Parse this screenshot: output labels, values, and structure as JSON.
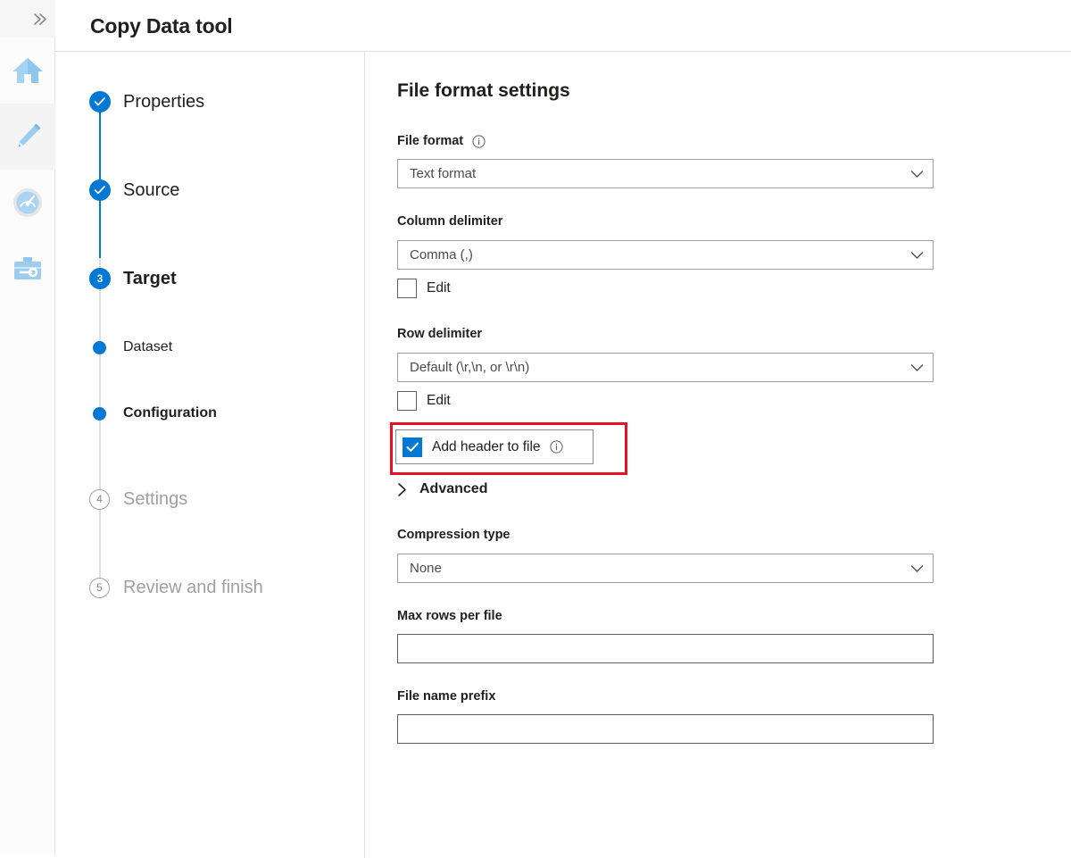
{
  "header": {
    "title": "Copy Data tool"
  },
  "rail": {
    "expand_icon": "double-chevron-right-icon",
    "items": [
      {
        "icon": "home-icon",
        "name": "home"
      },
      {
        "icon": "pencil-icon",
        "name": "author"
      },
      {
        "icon": "monitor-gauge-icon",
        "name": "monitor"
      },
      {
        "icon": "toolbox-icon",
        "name": "manage"
      }
    ]
  },
  "steps": [
    {
      "label": "Properties",
      "state": "done",
      "marker": "check"
    },
    {
      "label": "Source",
      "state": "done",
      "marker": "check"
    },
    {
      "label": "Target",
      "state": "current",
      "marker": "3"
    },
    {
      "label": "Dataset",
      "state": "substep",
      "marker": "dot"
    },
    {
      "label": "Configuration",
      "state": "substep-active",
      "marker": "dot"
    },
    {
      "label": "Settings",
      "state": "disabled",
      "marker": "4"
    },
    {
      "label": "Review and finish",
      "state": "disabled",
      "marker": "5"
    }
  ],
  "main": {
    "section_title": "File format settings",
    "fields": {
      "file_format": {
        "label": "File format",
        "info_icon": "info-circle-icon",
        "value": "Text format",
        "chevron": "chevron-down-icon"
      },
      "column_delimiter": {
        "label": "Column delimiter",
        "value": "Comma (,)",
        "chevron": "chevron-down-icon",
        "edit_label": "Edit",
        "edit_checked": false
      },
      "row_delimiter": {
        "label": "Row delimiter",
        "value": "Default (\\r,\\n, or \\r\\n)",
        "chevron": "chevron-down-icon",
        "edit_label": "Edit",
        "edit_checked": false
      },
      "add_header": {
        "label": "Add header to file",
        "info_icon": "info-circle-icon",
        "checked": true,
        "highlighted": true
      },
      "advanced": {
        "label": "Advanced",
        "chevron": "chevron-right-icon",
        "expanded": false
      },
      "compression_type": {
        "label": "Compression type",
        "value": "None",
        "chevron": "chevron-down-icon"
      },
      "max_rows_per_file": {
        "label": "Max rows per file",
        "value": "",
        "placeholder": ""
      },
      "file_name_prefix": {
        "label": "File name prefix",
        "value": "",
        "placeholder": ""
      }
    }
  },
  "colors": {
    "accent": "#0078d4",
    "annotation": "#e81123",
    "text": "#201f1e",
    "disabled_text": "#a19f9d",
    "border": "#a19f9d",
    "rail_bg": "#fbfbfb"
  }
}
